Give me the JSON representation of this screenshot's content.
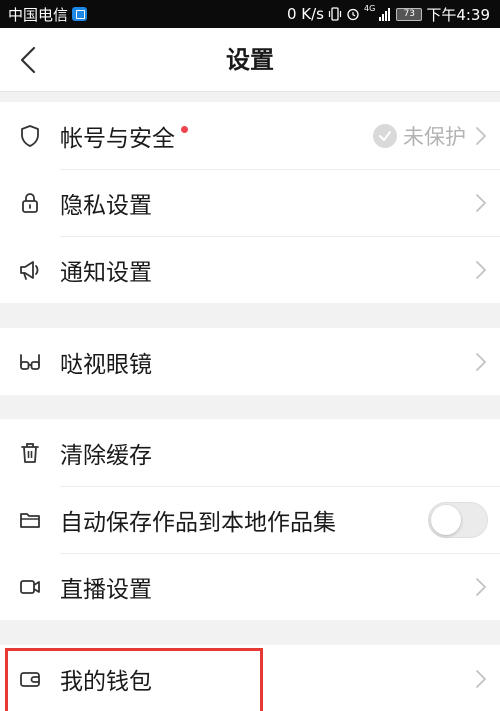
{
  "status_bar": {
    "carrier": "中国电信",
    "speed": "0 K/s",
    "network": "4G",
    "battery": "73",
    "time": "下午4:39"
  },
  "header": {
    "title": "设置"
  },
  "sections": {
    "account": {
      "label": "帐号与安全",
      "status": "未保护"
    },
    "privacy": {
      "label": "隐私设置"
    },
    "notification": {
      "label": "通知设置"
    },
    "glasses": {
      "label": "哒视眼镜"
    },
    "clear_cache": {
      "label": "清除缓存"
    },
    "auto_save": {
      "label": "自动保存作品到本地作品集",
      "enabled": false
    },
    "live": {
      "label": "直播设置"
    },
    "wallet": {
      "label": "我的钱包"
    }
  },
  "colors": {
    "accent_dot": "#f0454e",
    "highlight": "#e53935"
  }
}
